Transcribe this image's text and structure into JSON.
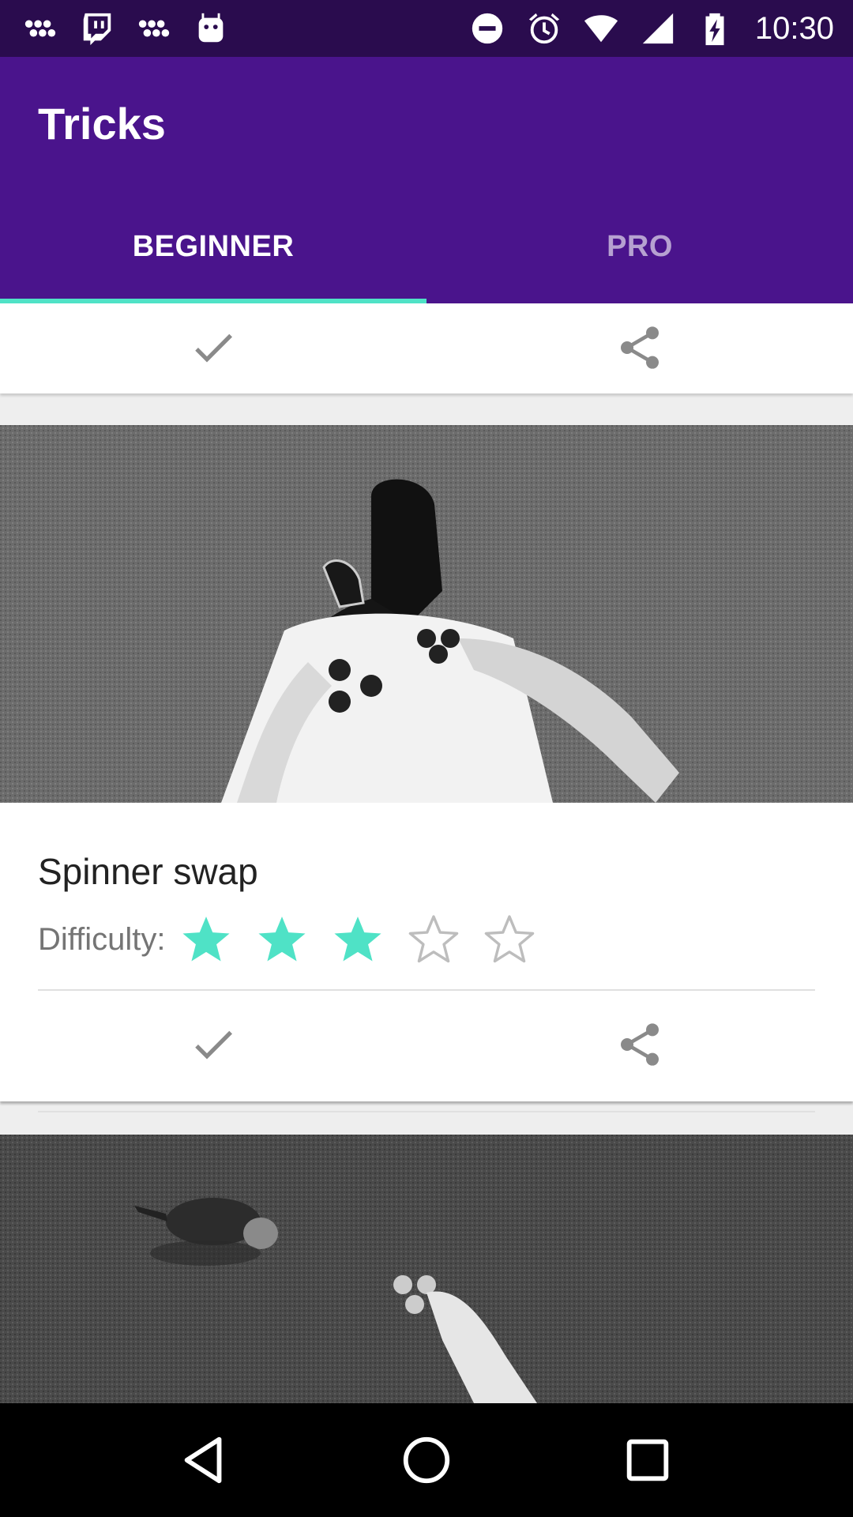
{
  "status_bar": {
    "time": "10:30",
    "left_icons": [
      "dots-icon",
      "twitch-icon",
      "dots-icon",
      "android-icon"
    ],
    "right_icons": [
      "do-not-disturb-icon",
      "alarm-icon",
      "wifi-icon",
      "signal-icon",
      "battery-charging-icon"
    ]
  },
  "app_bar": {
    "title": "Tricks",
    "tabs": [
      {
        "label": "BEGINNER",
        "active": true
      },
      {
        "label": "PRO",
        "active": false
      }
    ],
    "indicator_color": "#4fe2c6",
    "background_color": "#4a148c"
  },
  "cards": [
    {
      "title": "Spinner swap",
      "difficulty_label": "Difficulty:",
      "rating": 3,
      "max_rating": 5,
      "star_color": "#4fe2c6"
    }
  ],
  "actions": {
    "check_icon": "check-icon",
    "share_icon": "share-icon"
  },
  "nav_bar": [
    "back-icon",
    "home-icon",
    "recents-icon"
  ]
}
